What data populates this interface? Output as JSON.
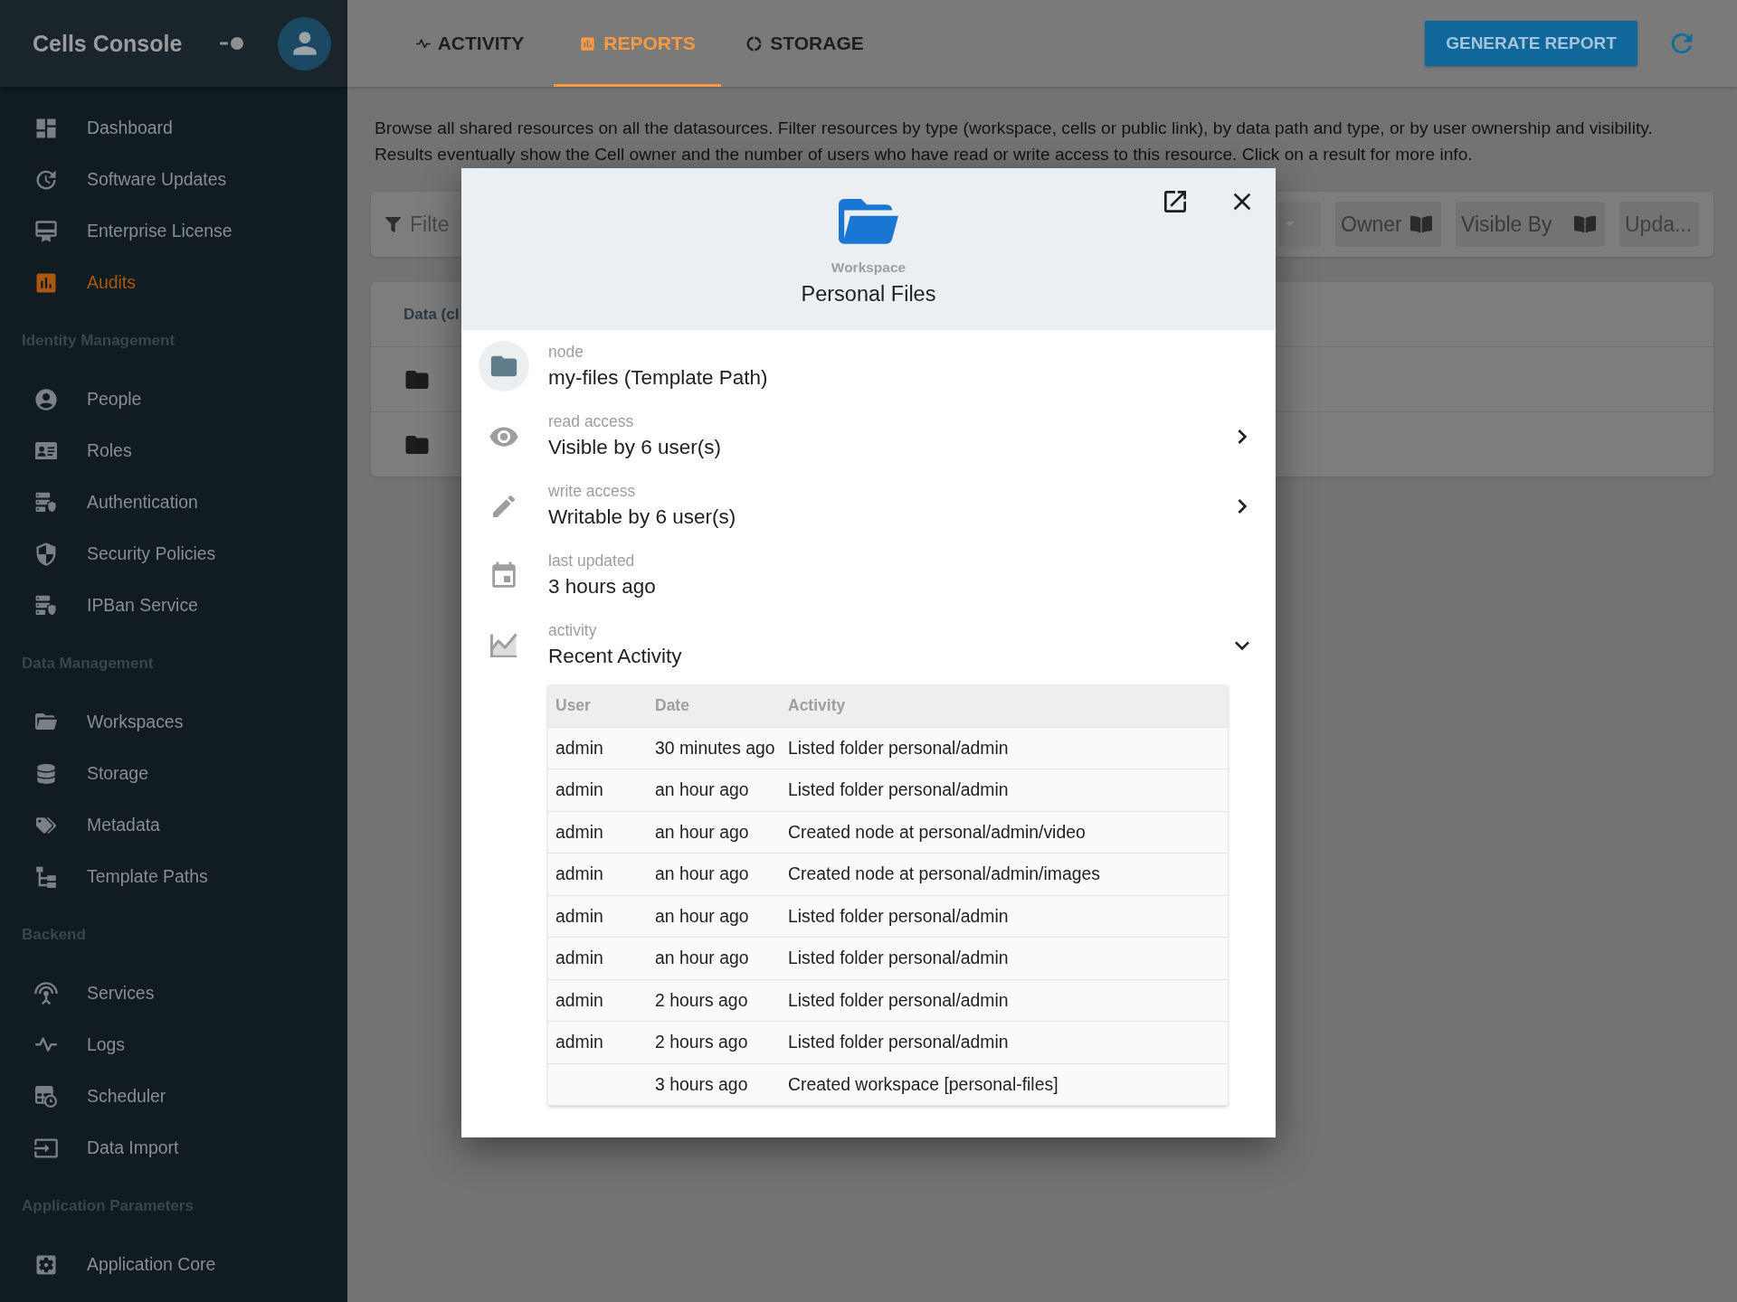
{
  "sidebar": {
    "title": "Cells Console",
    "sections": [
      {
        "items": [
          {
            "label": "Dashboard",
            "selected": false
          },
          {
            "label": "Software Updates",
            "selected": false
          },
          {
            "label": "Enterprise License",
            "selected": false
          },
          {
            "label": "Audits",
            "selected": true
          }
        ]
      },
      {
        "heading": "Identity Management",
        "items": [
          {
            "label": "People",
            "selected": false
          },
          {
            "label": "Roles",
            "selected": false
          },
          {
            "label": "Authentication",
            "selected": false
          },
          {
            "label": "Security Policies",
            "selected": false
          },
          {
            "label": "IPBan Service",
            "selected": false
          }
        ]
      },
      {
        "heading": "Data Management",
        "items": [
          {
            "label": "Workspaces",
            "selected": false
          },
          {
            "label": "Storage",
            "selected": false
          },
          {
            "label": "Metadata",
            "selected": false
          },
          {
            "label": "Template Paths",
            "selected": false
          }
        ]
      },
      {
        "heading": "Backend",
        "items": [
          {
            "label": "Services",
            "selected": false
          },
          {
            "label": "Logs",
            "selected": false
          },
          {
            "label": "Scheduler",
            "selected": false
          },
          {
            "label": "Data Import",
            "selected": false
          }
        ]
      },
      {
        "heading": "Application Parameters",
        "items": [
          {
            "label": "Application Core",
            "selected": false
          }
        ]
      }
    ]
  },
  "tabs": [
    {
      "label": "ACTIVITY",
      "selected": false
    },
    {
      "label": "REPORTS",
      "selected": true
    },
    {
      "label": "STORAGE",
      "selected": false
    }
  ],
  "toolbar": {
    "action": "GENERATE REPORT"
  },
  "description": "Browse all shared resources on all the datasources. Filter resources by type (workspace, cells or public link), by data path and type, or by user ownership and visibility. Results eventually show the Cell owner and the number of users who have read or write access to this resource. Click on a result for more info.",
  "filter_bar": {
    "search": {
      "placeholder": "Filte"
    },
    "chips": [
      {
        "label": "Owner"
      },
      {
        "label": "Visible By"
      }
    ],
    "date_field": {
      "placeholder": "Upda..."
    }
  },
  "results_table": {
    "columns": [
      "Data (cl"
    ],
    "rows": [
      {
        "kind": "folder"
      },
      {
        "kind": "folder"
      }
    ]
  },
  "modal": {
    "kind_label": "Workspace",
    "title": "Personal Files",
    "fields": [
      {
        "kind": "info",
        "label": "node",
        "value": "my-files (Template Path)"
      },
      {
        "kind": "link",
        "label": "read access",
        "value": "Visible by 6 user(s)"
      },
      {
        "kind": "link",
        "label": "write access",
        "value": "Writable by 6 user(s)"
      },
      {
        "kind": "info",
        "label": "last updated",
        "value": "3 hours ago"
      },
      {
        "kind": "expander",
        "label": "activity",
        "value": "Recent Activity",
        "expanded": true,
        "table": {
          "columns": [
            "User",
            "Date",
            "Activity"
          ],
          "rows": [
            {
              "user": "admin",
              "date": "30 minutes ago",
              "activity": "Listed folder personal/admin"
            },
            {
              "user": "admin",
              "date": "an hour ago",
              "activity": "Listed folder personal/admin"
            },
            {
              "user": "admin",
              "date": "an hour ago",
              "activity": "Created node at personal/admin/video"
            },
            {
              "user": "admin",
              "date": "an hour ago",
              "activity": "Created node at personal/admin/images"
            },
            {
              "user": "admin",
              "date": "an hour ago",
              "activity": "Listed folder personal/admin"
            },
            {
              "user": "admin",
              "date": "an hour ago",
              "activity": "Listed folder personal/admin"
            },
            {
              "user": "admin",
              "date": "2 hours ago",
              "activity": "Listed folder personal/admin"
            },
            {
              "user": "admin",
              "date": "2 hours ago",
              "activity": "Listed folder personal/admin"
            },
            {
              "date": "3 hours ago",
              "activity": "Created workspace [personal-files]"
            }
          ]
        }
      }
    ]
  }
}
